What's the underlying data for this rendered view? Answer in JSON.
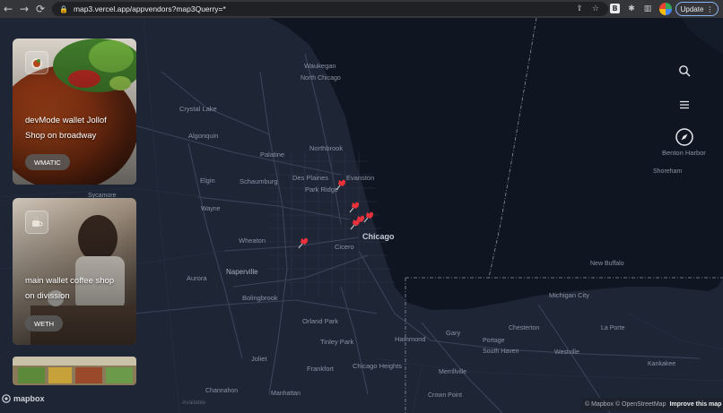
{
  "browser": {
    "url": "map3.vercel.app/appvendors?map3Querry=*",
    "update_label": "Update",
    "extension_letter": "B"
  },
  "vendors": [
    {
      "title": "devMode wallet Jollof Shop on broadway",
      "token": "WMATIC"
    },
    {
      "title": "main wallet coffee shop on divission",
      "token": "WETH"
    },
    {
      "title": "",
      "token": ""
    }
  ],
  "map": {
    "places": {
      "waukegan": "Waukegan",
      "north_chicago": "North Chicago",
      "crystal_lake": "Crystal Lake",
      "algonquin": "Algonquin",
      "northbrook": "Northbrook",
      "palatine": "Palatine",
      "elgin": "Elgin",
      "schaumburg": "Schaumburg",
      "des_plaines": "Des Plaines",
      "evanston": "Evanston",
      "park_ridge": "Park Ridge",
      "wayne": "Wayne",
      "sycamore": "Sycamore",
      "wheaton": "Wheaton",
      "chicago": "Chicago",
      "cicero": "Cicero",
      "naperville": "Naperville",
      "aurora": "Aurora",
      "bolingbrook": "Bolingbrook",
      "orland_park": "Orland Park",
      "tinley_park": "Tinley Park",
      "joliet": "Joliet",
      "frankfort": "Frankfort",
      "chicago_heights": "Chicago Heights",
      "channahon": "Channahon",
      "manhattan": "Manhattan",
      "hammond": "Hammond",
      "gary": "Gary",
      "portage": "Portage",
      "chesterton": "Chesterton",
      "south_haven": "South Haven",
      "westville": "Westville",
      "merrillville": "Merrillville",
      "crown_point": "Crown Point",
      "michigan_city": "Michigan City",
      "la_porte": "La Porte",
      "new_buffalo": "New Buffalo",
      "benton_harbor": "Benton Harbor",
      "shoreham": "Shoreham",
      "kankakee": "Kankakee"
    },
    "pin_color": "#e8313a"
  },
  "branding": {
    "mapbox": "mapbox",
    "attribution_prefix": "© Mapbox © OpenStreetMap",
    "improve": "Improve this map",
    "status_text": "Available"
  }
}
